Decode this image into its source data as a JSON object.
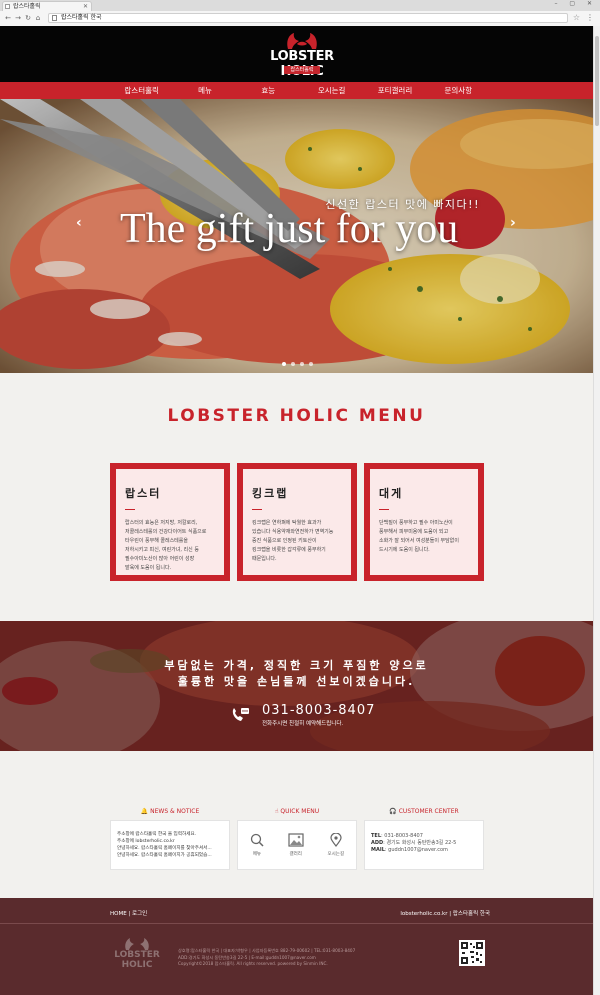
{
  "browser": {
    "tab_title": "랍스타홀릭",
    "address": "랍스타홀릭 한국",
    "window_controls": "– ▢ ✕"
  },
  "site": {
    "logo_text": "LOBSTER HOLIC",
    "logo_sub": "랍스터홀릭",
    "nav": [
      "랍스터홀릭",
      "메뉴",
      "효능",
      "오시는길",
      "포티갤러리",
      "문의사항"
    ]
  },
  "hero": {
    "kicker": "신선한 랍스터 맛에 빠지다!!",
    "title": "The gift just for you",
    "prev_arrow": "‹",
    "next_arrow": "›",
    "slide_count": 4,
    "active_slide": 1
  },
  "menu": {
    "title": "LOBSTER HOLIC MENU",
    "cards": [
      {
        "name": "랍스터",
        "desc": [
          "랍스터의 효능은 저지방, 저칼로리,",
          "저콜레스테롤의 건강다이어트 식품으로",
          "타우린이 풍부해 콜레스테롤을",
          "저하시키고 피신, 여린가녀, 리신 등",
          "필수아미노산이 많아 어린이 성장",
          "발육에 도움이 됩니다."
        ]
      },
      {
        "name": "킹크랩",
        "desc": [
          "킹크랩은 연하펴에 탁월한 효과가",
          "있습니다 식용약재와연전하가 면역기능",
          "증진 식품으로 인정된 키토산이",
          "킹크랩을 비롯한 갑각류에 풍부하기",
          "때문입니다."
        ]
      },
      {
        "name": "대게",
        "desc": [
          "단백질이 풍부하고 필수 아미노산이",
          "풍부해서 피부미용에 도움이 되고",
          "소화가 잘 되어서 여성분들이 부담없이",
          "드시기에 도움이 됩니다."
        ]
      }
    ]
  },
  "promo": {
    "line1": "부담없는 가격, 정직한 크기 푸짐한 양으로",
    "line2": "훌륭한 맛을 손님들께 선보이겠습니다.",
    "phone": "031-8003-8407",
    "phone_note": "전화주시면 친절히 예약해드립니다."
  },
  "info": {
    "news_title": "NEWS & NOTICE",
    "news_items": [
      "주소창에 랍스타홀릭 한국 을 입력하세요.",
      "주소창에 lobsterholic.co.kr",
      "안녕하세요. 랍스타홀릭 홈페이지를 찾아주셔서...",
      "안녕하세요. 랍스타홀릭 홈페이지가 공휴되었습..."
    ],
    "quick_title": "QUICK MENU",
    "quick_items": [
      "메뉴",
      "갤러리",
      "오시는길"
    ],
    "cs_title": "CUSTOMER CENTER",
    "tel_label": "TEL",
    "tel": ": 031-8003-8407",
    "add_label": "ADD",
    "address": ": 경기도 화성시 동탄반송3길 22-5",
    "mail_label": "MAIL",
    "mail": ": guddn1007@naver.com"
  },
  "footer": {
    "left": "HOME | 로그인",
    "right": "lobsterholic.co.kr | 랍스타홀릭 한국",
    "logo": "LOBSTER HOLIC",
    "lines": [
      "상호명:랍스타홀릭 한국 | 대표자:박형우 | 사업자등록번호 882-79-00602 | TEL:031-8003-8407",
      "ADD:경기도 화성시 동탄반송3길 22-5 | E-mail:guddn1007@naver.com",
      "Copyright©2018 랍스타홀릭. All rights reserved. powered by Sinmin INC."
    ]
  },
  "colors": {
    "brand_red": "#c8232b",
    "footer_brown": "#5a2b2d",
    "header_black": "#050505"
  }
}
